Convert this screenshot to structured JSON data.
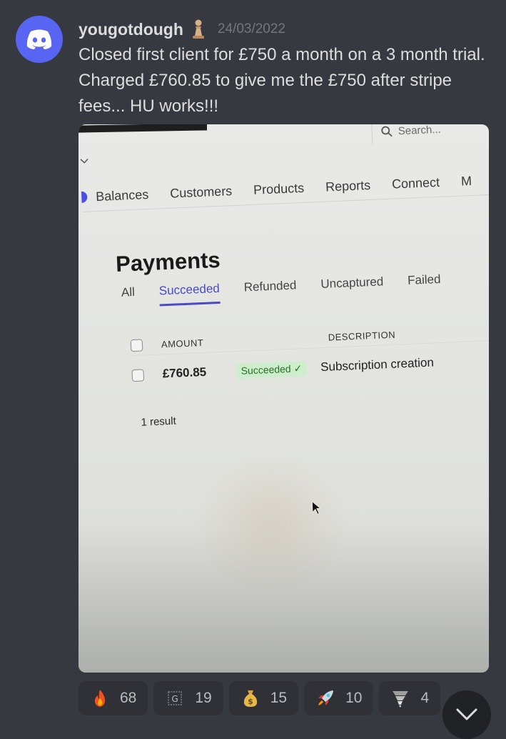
{
  "message": {
    "username": "yougotdough",
    "timestamp": "24/03/2022",
    "text": "Closed first client for £750 a month on a 3 month trial. Charged £760.85 to give me the £750 after stripe fees... HU works!!!"
  },
  "attachment": {
    "search_placeholder": "Search...",
    "nav": [
      "Balances",
      "Customers",
      "Products",
      "Reports",
      "Connect",
      "M"
    ],
    "page_title": "Payments",
    "tabs": [
      {
        "label": "All",
        "active": false
      },
      {
        "label": "Succeeded",
        "active": true
      },
      {
        "label": "Refunded",
        "active": false
      },
      {
        "label": "Uncaptured",
        "active": false
      },
      {
        "label": "Failed",
        "active": false
      }
    ],
    "table": {
      "headers": [
        "AMOUNT",
        "DESCRIPTION"
      ],
      "rows": [
        {
          "amount": "£760.85",
          "status": "Succeeded ✓",
          "description": "Subscription creation"
        }
      ]
    },
    "result_count": "1 result"
  },
  "reactions": [
    {
      "emoji": "fire-icon",
      "count": "68"
    },
    {
      "emoji": "g-icon",
      "count": "19"
    },
    {
      "emoji": "money-bag-icon",
      "count": "15"
    },
    {
      "emoji": "rocket-icon",
      "count": "10"
    },
    {
      "emoji": "tornado-icon",
      "count": "4"
    }
  ],
  "colors": {
    "background": "#36393f",
    "avatar": "#5865f2",
    "reaction_bg": "#2f3136",
    "tab_active": "#4949c9",
    "badge_bg": "#cdeecb"
  }
}
